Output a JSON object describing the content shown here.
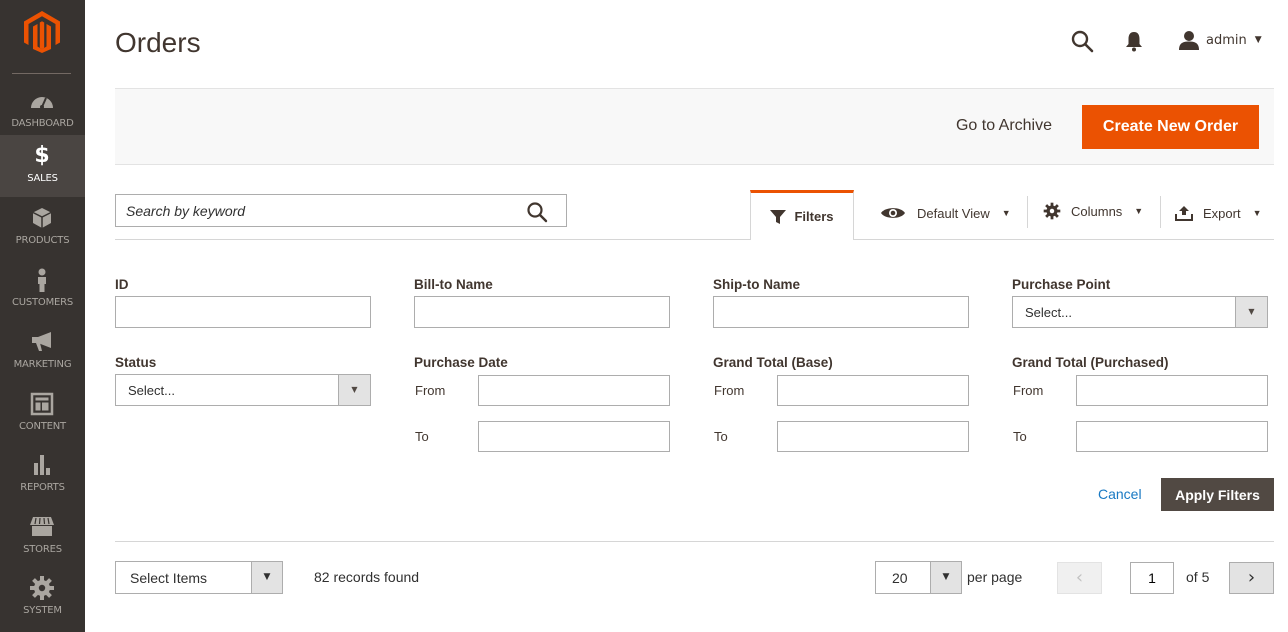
{
  "sidebar": {
    "items": [
      {
        "key": "dashboard",
        "label": "DASHBOARD",
        "icon": "dashboard-icon"
      },
      {
        "key": "sales",
        "label": "SALES",
        "icon": "dollar-icon",
        "active": true
      },
      {
        "key": "products",
        "label": "PRODUCTS",
        "icon": "box-icon"
      },
      {
        "key": "customers",
        "label": "CUSTOMERS",
        "icon": "person-icon"
      },
      {
        "key": "marketing",
        "label": "MARKETING",
        "icon": "megaphone-icon"
      },
      {
        "key": "content",
        "label": "CONTENT",
        "icon": "layout-icon"
      },
      {
        "key": "reports",
        "label": "REPORTS",
        "icon": "bar-chart-icon"
      },
      {
        "key": "stores",
        "label": "STORES",
        "icon": "storefront-icon"
      },
      {
        "key": "system",
        "label": "SYSTEM",
        "icon": "gear-icon"
      }
    ]
  },
  "header": {
    "title": "Orders",
    "user": "admin"
  },
  "actions": {
    "archive_label": "Go to Archive",
    "create_label": "Create New Order"
  },
  "colors": {
    "accent": "#eb5202",
    "sidebar_bg": "#373330",
    "link": "#1979c3",
    "dark_button": "#514943"
  },
  "toolbar": {
    "search_placeholder": "Search by keyword",
    "filters_label": "Filters",
    "view_label": "Default View",
    "columns_label": "Columns",
    "export_label": "Export"
  },
  "filters": {
    "id_label": "ID",
    "bill_to_label": "Bill-to Name",
    "ship_to_label": "Ship-to Name",
    "purchase_point_label": "Purchase Point",
    "purchase_point_value": "Select...",
    "status_label": "Status",
    "status_value": "Select...",
    "purchase_date_label": "Purchase Date",
    "grand_total_base_label": "Grand Total (Base)",
    "grand_total_purchased_label": "Grand Total (Purchased)",
    "from_label": "From",
    "to_label": "To",
    "cancel_label": "Cancel",
    "apply_label": "Apply Filters"
  },
  "grid": {
    "mass_action_label": "Select Items",
    "records_text": "82 records found",
    "per_page_value": "20",
    "per_page_label": "per page",
    "current_page": "1",
    "total_pages_text": "of 5",
    "prev_glyph": "‹",
    "next_glyph": "›"
  }
}
